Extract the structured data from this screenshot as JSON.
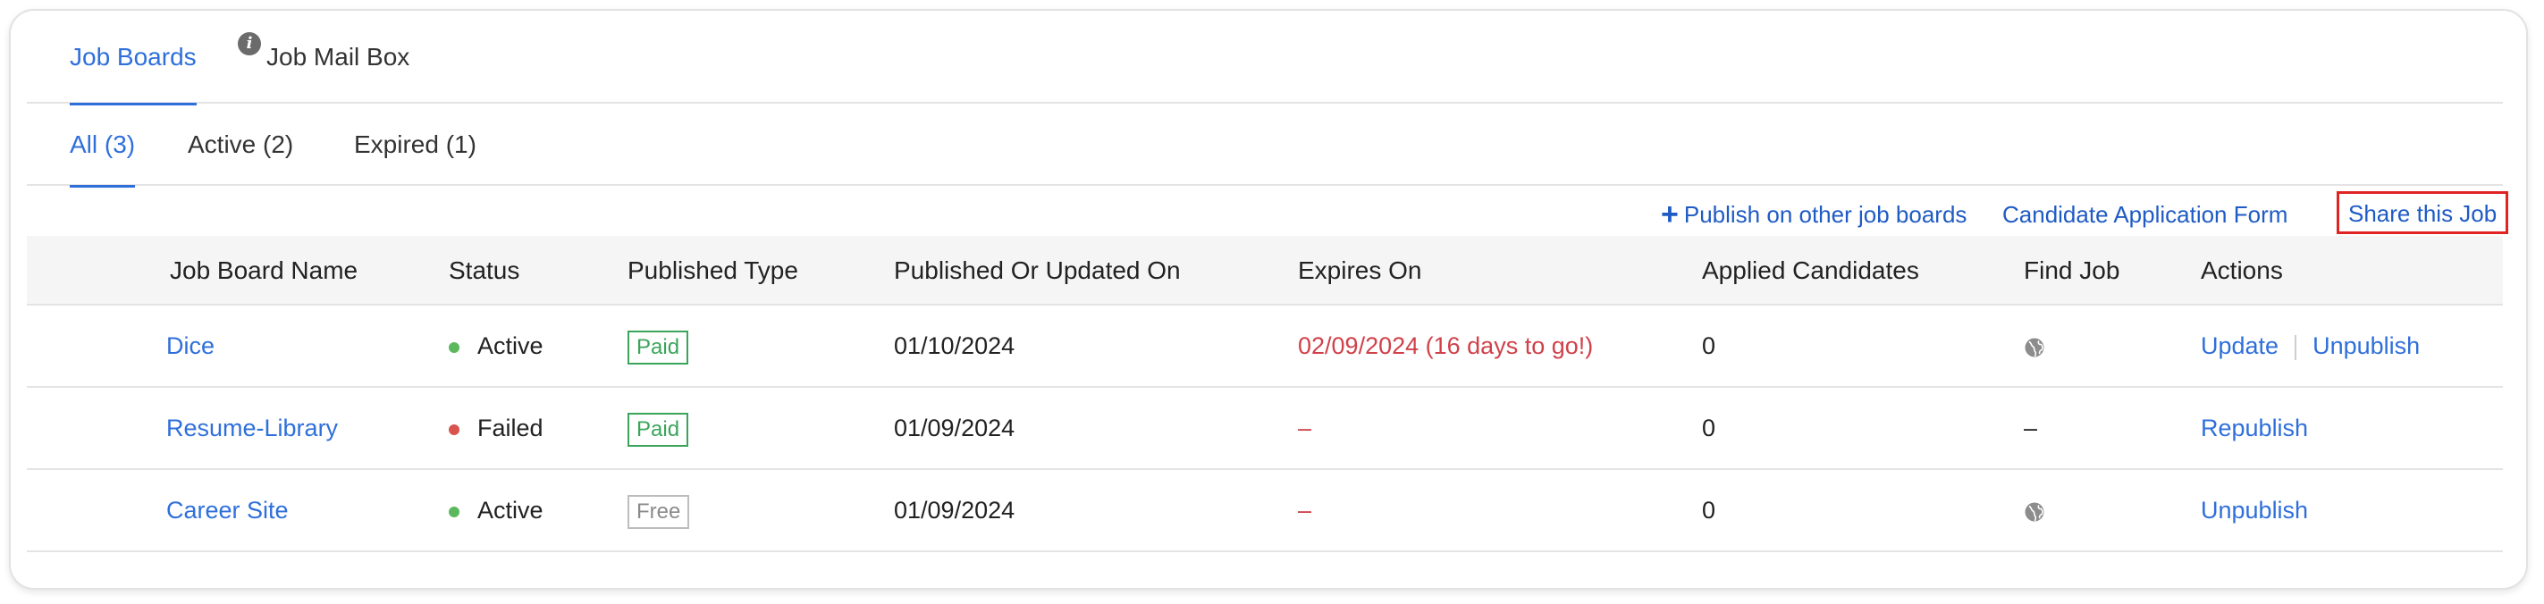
{
  "main_tabs": [
    "Job Boards",
    "Job Mail Box"
  ],
  "sub_tabs": [
    "All (3)",
    "Active (2)",
    "Expired (1)"
  ],
  "toolbar": {
    "publish_label": "Publish on other job boards",
    "form_label": "Candidate Application Form",
    "share_label": "Share this Job"
  },
  "table": {
    "columns": [
      "Job Board Name",
      "Status",
      "Published Type",
      "Published Or Updated On",
      "Expires On",
      "Applied Candidates",
      "Find Job",
      "Actions"
    ],
    "rows": [
      {
        "name": "Dice",
        "status": "Active",
        "type": "Paid",
        "date": "01/10/2024",
        "expires": "02/09/2024 (16 days to go!)",
        "applied": "0",
        "find": "globe-icon",
        "actions": [
          "Update",
          "Unpublish"
        ]
      },
      {
        "name": "Resume-Library",
        "status": "Failed",
        "type": "Paid",
        "date": "01/09/2024",
        "expires": "–",
        "applied": "0",
        "find": "–",
        "actions": [
          "Republish"
        ]
      },
      {
        "name": "Career Site",
        "status": "Active",
        "type": "Free",
        "date": "01/09/2024",
        "expires": "–",
        "applied": "0",
        "find": "globe-icon",
        "actions": [
          "Unpublish"
        ]
      }
    ]
  },
  "colors": {
    "accent": "#2f6fdb",
    "active_dot": "#5cb85c",
    "failed_dot": "#d9534f",
    "paid": "#3aa55a",
    "expiry_red": "#d0414a",
    "highlight": "#e02424"
  }
}
